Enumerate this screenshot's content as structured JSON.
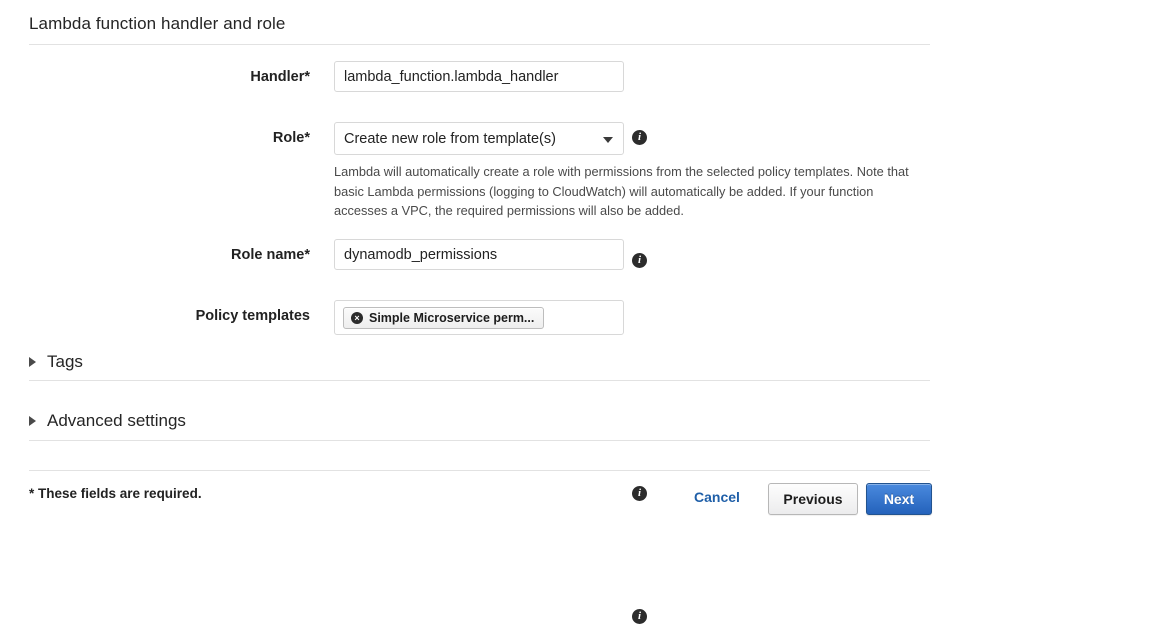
{
  "section": {
    "title": "Lambda function handler and role"
  },
  "fields": {
    "handler": {
      "label": "Handler*",
      "value": "lambda_function.lambda_handler",
      "info_glyph": "i"
    },
    "role": {
      "label": "Role*",
      "value": "Create new role from template(s)",
      "help": "Lambda will automatically create a role with permissions from the selected policy templates. Note that basic Lambda permissions (logging to CloudWatch) will automatically be added. If your function accesses a VPC, the required permissions will also be added.",
      "info_glyph": "i"
    },
    "role_name": {
      "label": "Role name*",
      "value": "dynamodb_permissions",
      "info_glyph": "i"
    },
    "policy_templates": {
      "label": "Policy templates",
      "chip_label": "Simple Microservice perm...",
      "chip_remove_glyph": "×",
      "info_glyph": "i"
    }
  },
  "collapsibles": [
    {
      "label": "Tags"
    },
    {
      "label": "Advanced settings"
    }
  ],
  "footer": {
    "required_note": "* These fields are required.",
    "cancel_label": "Cancel",
    "previous_label": "Previous",
    "next_label": "Next",
    "next_color": "#2462bb",
    "link_color": "#1f5fa8"
  }
}
